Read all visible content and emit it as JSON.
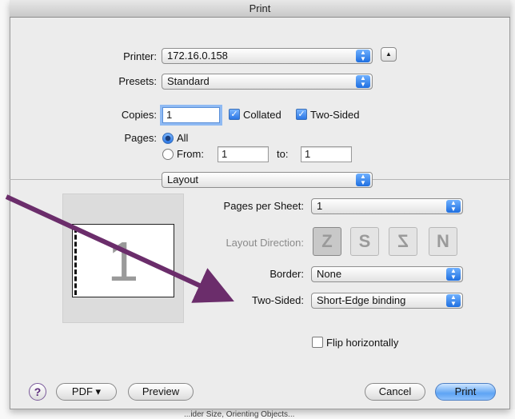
{
  "window": {
    "title": "Print"
  },
  "printer": {
    "label": "Printer:",
    "value": "172.16.0.158"
  },
  "presets": {
    "label": "Presets:",
    "value": "Standard"
  },
  "copies": {
    "label": "Copies:",
    "value": "1",
    "collated_label": "Collated",
    "collated": true,
    "two_sided_label": "Two-Sided",
    "two_sided": true
  },
  "pages": {
    "label": "Pages:",
    "all_label": "All",
    "from_label": "From:",
    "from_value": "1",
    "to_label": "to:",
    "to_value": "1",
    "selected": "All"
  },
  "section": {
    "value": "Layout"
  },
  "layout": {
    "preview_page_number": "1",
    "pages_per_sheet_label": "Pages per Sheet:",
    "pages_per_sheet_value": "1",
    "direction_label": "Layout Direction:",
    "border_label": "Border:",
    "border_value": "None",
    "two_sided_label": "Two-Sided:",
    "two_sided_value": "Short-Edge binding",
    "flip_label": "Flip horizontally",
    "flip": false
  },
  "footer": {
    "help": "?",
    "pdf_label": "PDF ▾",
    "preview_label": "Preview",
    "cancel_label": "Cancel",
    "print_label": "Print"
  },
  "background_snippet": "...ider Size, Orienting Objects...",
  "colors": {
    "accent": "#2a76e4",
    "annotation_arrow": "#6b2d6b"
  },
  "icons": {
    "popup": "up-down-chevron-icon",
    "disclosure": "triangle-up-icon"
  }
}
